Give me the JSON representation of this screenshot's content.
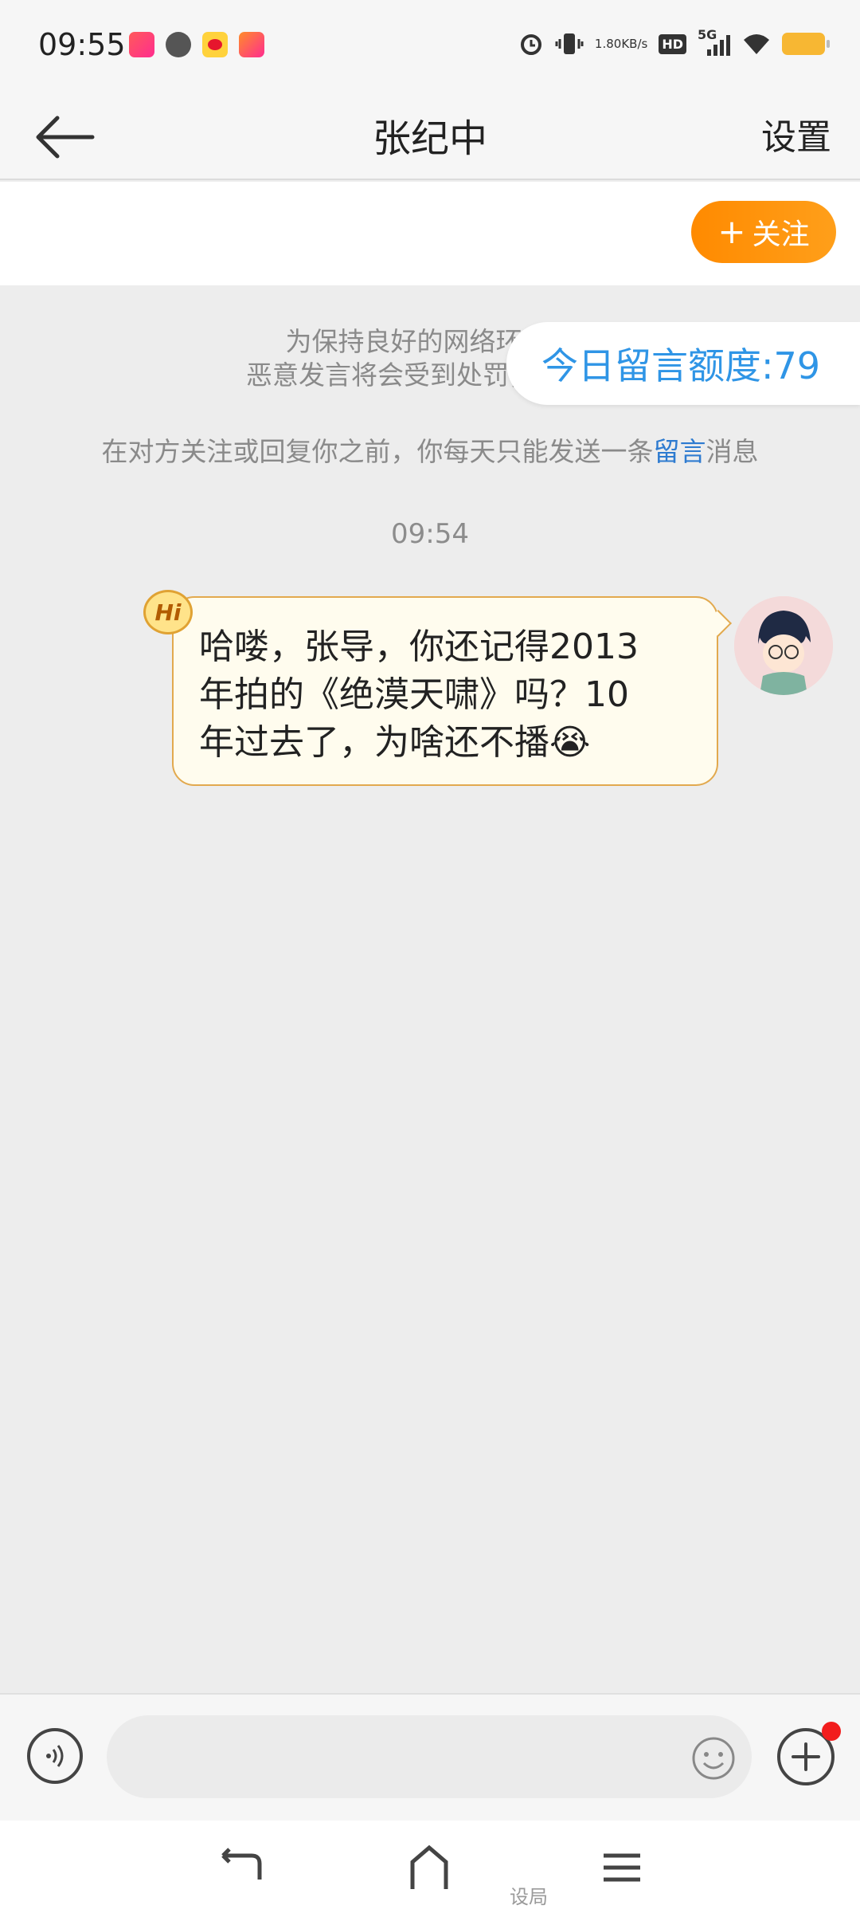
{
  "status_bar": {
    "time": "09:55",
    "net_speed_value": "1.80",
    "net_speed_unit": "KB/s",
    "hd_label": "HD",
    "signal_label": "5G",
    "notification_icons": [
      "video-app-icon",
      "chat-bubble-icon",
      "weibo-icon",
      "video-app-icon"
    ],
    "right_icons": [
      "alarm-icon",
      "vibrate-icon",
      "hd-icon",
      "signal-5g-icon",
      "wifi-icon",
      "battery-icon"
    ],
    "battery_color": "#f7b733"
  },
  "nav": {
    "title": "张纪中",
    "settings_label": "设置"
  },
  "follow": {
    "label": "关注",
    "color": "#ff8a00"
  },
  "notices": {
    "line1": "为保持良好的网络环境，",
    "line2": "恶意发言将会受到处罚，详细细",
    "line3_before": "在对方关注或回复你之前，你每天只能发送一条",
    "line3_link": "留言",
    "line3_after": "消息"
  },
  "quota": {
    "label": "今日留言额度:79",
    "color": "#2f95e6"
  },
  "conversation": {
    "timestamp": "09:54",
    "hi_badge": "Hi",
    "message_line1": "哈喽，张导，你还记得2013",
    "message_line2": "年拍的《绝漠天啸》吗？10",
    "message_line3": "年过去了，为啥还不播",
    "message_emoji": "😭",
    "bubble_color": "#fffcee",
    "bubble_border": "#e2a94e"
  },
  "input": {
    "placeholder": ""
  },
  "system_nav": {
    "hint_text": "设局"
  }
}
